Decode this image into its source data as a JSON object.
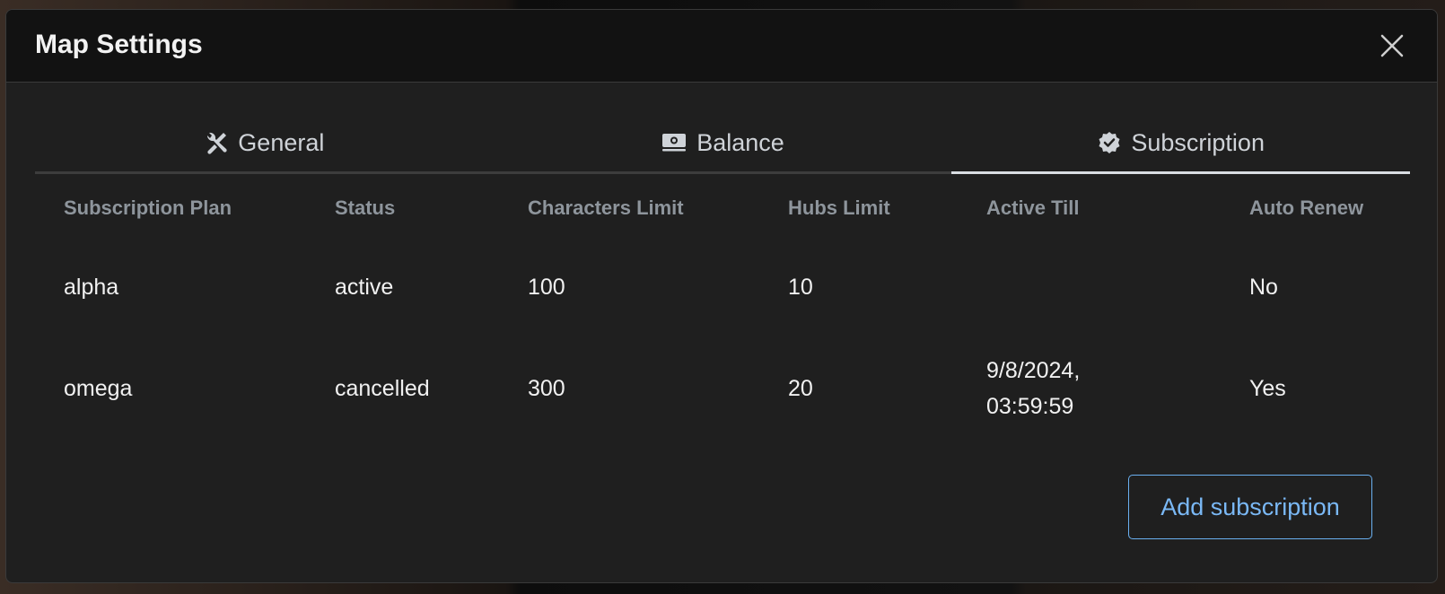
{
  "dialog": {
    "title": "Map Settings"
  },
  "tabs": [
    {
      "label": "General",
      "icon": "wrench-screwdriver-icon"
    },
    {
      "label": "Balance",
      "icon": "money-icon"
    },
    {
      "label": "Subscription",
      "icon": "verified-badge-icon",
      "active": true
    }
  ],
  "table": {
    "headers": [
      "Subscription Plan",
      "Status",
      "Characters Limit",
      "Hubs Limit",
      "Active Till",
      "Auto Renew"
    ],
    "rows": [
      {
        "plan": "alpha",
        "status": "active",
        "characters_limit": "100",
        "hubs_limit": "10",
        "active_till_date": "",
        "active_till_time": "",
        "auto_renew": "No"
      },
      {
        "plan": "omega",
        "status": "cancelled",
        "characters_limit": "300",
        "hubs_limit": "20",
        "active_till_date": "9/8/2024,",
        "active_till_time": "03:59:59",
        "auto_renew": "Yes"
      }
    ]
  },
  "actions": {
    "add_label": "Add subscription"
  },
  "colors": {
    "accent": "#6ab0f0",
    "dialog_bg": "#1f1f1f",
    "header_bg": "#121212"
  }
}
